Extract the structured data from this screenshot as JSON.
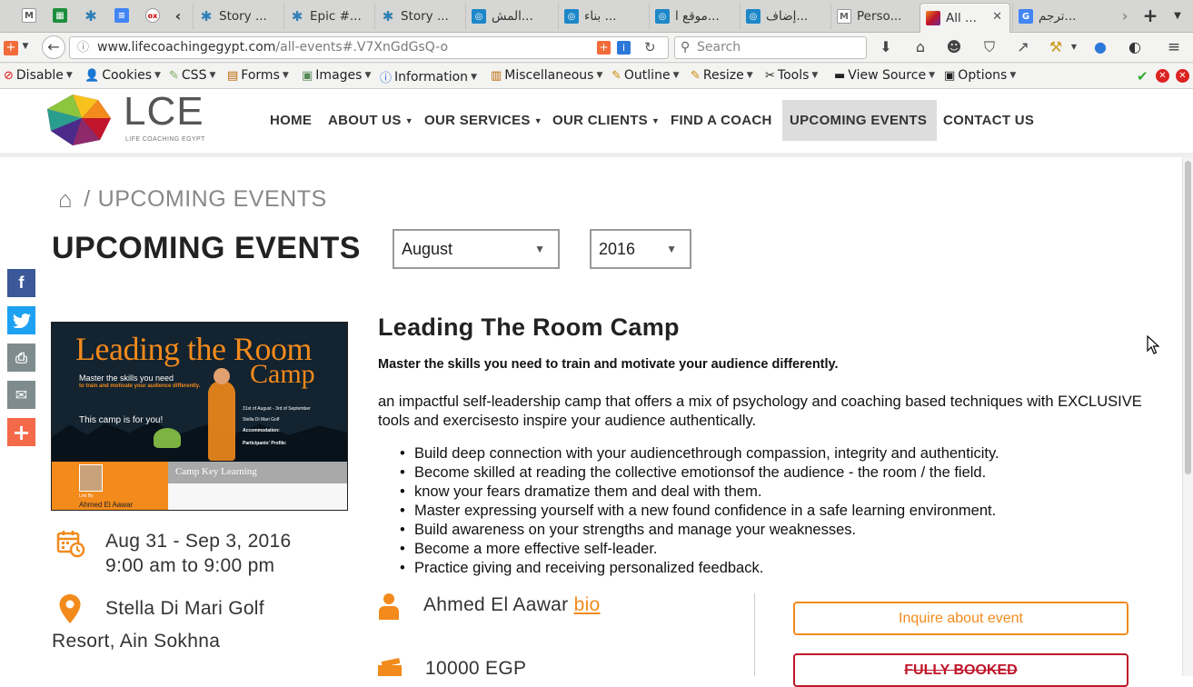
{
  "browser": {
    "tabs": [
      {
        "label": "Story ...",
        "icon": "snowflake-icon"
      },
      {
        "label": "Epic #...",
        "icon": "snowflake-icon"
      },
      {
        "label": "Story ...",
        "icon": "snowflake-icon"
      },
      {
        "label": "المش...",
        "icon": "circle-icon"
      },
      {
        "label": "بناء ...",
        "icon": "circle-icon"
      },
      {
        "label": "موقع ا...",
        "icon": "circle-icon"
      },
      {
        "label": "إضاف...",
        "icon": "circle-icon"
      },
      {
        "label": "Perso...",
        "icon": "gmail-icon"
      },
      {
        "label": "All ...",
        "icon": "lce-icon",
        "active": true
      },
      {
        "label": "ترجم...",
        "icon": "translate-icon"
      }
    ],
    "url_domain": "www.lifecoachingegypt.com",
    "url_path": "/all-events#.V7XnGdGsQ-o",
    "search_placeholder": "Search",
    "devbar": [
      {
        "label": "Disable",
        "icon": "disable-icon"
      },
      {
        "label": "Cookies",
        "icon": "cookies-icon"
      },
      {
        "label": "CSS",
        "icon": "css-icon"
      },
      {
        "label": "Forms",
        "icon": "forms-icon"
      },
      {
        "label": "Images",
        "icon": "images-icon"
      },
      {
        "label": "Information",
        "icon": "info-icon"
      },
      {
        "label": "Miscellaneous",
        "icon": "misc-icon"
      },
      {
        "label": "Outline",
        "icon": "outline-icon"
      },
      {
        "label": "Resize",
        "icon": "resize-icon"
      },
      {
        "label": "Tools",
        "icon": "tools-icon"
      },
      {
        "label": "View Source",
        "icon": "source-icon"
      },
      {
        "label": "Options",
        "icon": "options-icon"
      }
    ]
  },
  "site": {
    "logo_text": "LCE",
    "logo_sub": "LIFE COACHING EGYPT",
    "menu": [
      "HOME",
      "ABOUT US",
      "OUR SERVICES",
      "OUR CLIENTS",
      "FIND A COACH",
      "UPCOMING EVENTS",
      "CONTACT US"
    ],
    "accent": "#f28a1c"
  },
  "breadcrumb": {
    "sep": "/",
    "current": "UPCOMING EVENTS"
  },
  "page_title": "UPCOMING EVENTS",
  "filters": {
    "month": "August",
    "year": "2016"
  },
  "share": [
    "facebook-icon",
    "twitter-icon",
    "print-icon",
    "email-icon",
    "more-icon"
  ],
  "poster": {
    "title_line1": "Leading the Room",
    "title_line2": "Camp",
    "tagline": "Master the skills you need",
    "tagline2": "to train and motivate your audience differently.",
    "for_you": "This camp is for you!",
    "dates": "31st of August - 3rd of September",
    "venue": "Stella Di Mari Golf",
    "accommodation": "Accommodation:",
    "participants": "Participants' Profile:",
    "key_learning": "Camp Key Learning",
    "led_by": "Led By",
    "trainer": "Ahmed El Aawar"
  },
  "event": {
    "title": "Leading The Room Camp",
    "subtitle": "Master the skills you need to train and motivate your audience differently.",
    "description": "an impactful self-leadership camp that offers a mix of psychology and coaching based techniques with EXCLUSIVE tools and exercisesto inspire your audience authentically.",
    "bullets": [
      "Build deep connection with your audiencethrough compassion, integrity and authenticity.",
      "Become skilled at reading the collective emotionsof the audience - the room / the field.",
      "know your fears dramatize them and deal with them.",
      "Master expressing yourself with a new found confidence in a safe learning environment.",
      "Build awareness on your strengths and manage your weaknesses.",
      "Become a more effective self-leader.",
      "Practice giving and receiving personalized feedback."
    ],
    "date_range": "Aug 31 - Sep 3, 2016",
    "time_range": "9:00 am to 9:00 pm",
    "location_line1": "Stella Di Mari Golf",
    "location_line2": "Resort, Ain Sokhna",
    "trainer": "Ahmed El Aawar",
    "trainer_link": "bio",
    "price": "10000 EGP",
    "inquire_label": "Inquire about event",
    "booked_label": "FULLY BOOKED"
  }
}
